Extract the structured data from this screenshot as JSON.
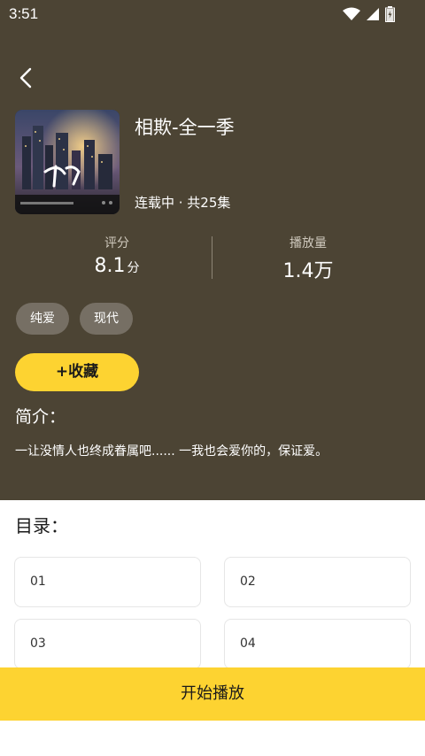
{
  "status_bar": {
    "time": "3:51",
    "icons": [
      "wifi-icon",
      "cellular-signal-icon",
      "battery-icon"
    ]
  },
  "header": {
    "back_icon": "chevron-left-icon"
  },
  "drama": {
    "title": "相欺-全一季",
    "meta": "连载中 · 共25集",
    "cover_icon": "cover-image"
  },
  "stats": {
    "rating_label": "评分",
    "rating_value": "8.1",
    "rating_unit": "分",
    "plays_label": "播放量",
    "plays_value": "1.4万"
  },
  "tags": [
    "纯爱",
    "现代"
  ],
  "actions": {
    "collect_label": "+收藏",
    "play_label": "开始播放"
  },
  "intro": {
    "heading": "简介：",
    "text": "一让没情人也终成眷属吧...... 一我也会爱你的，保证爱。"
  },
  "catalog": {
    "heading": "目录：",
    "episodes": [
      "01",
      "02",
      "03",
      "04"
    ]
  },
  "colors": {
    "header_bg": "#4c4434",
    "accent": "#fdd331",
    "tag_bg": "#766f64"
  }
}
